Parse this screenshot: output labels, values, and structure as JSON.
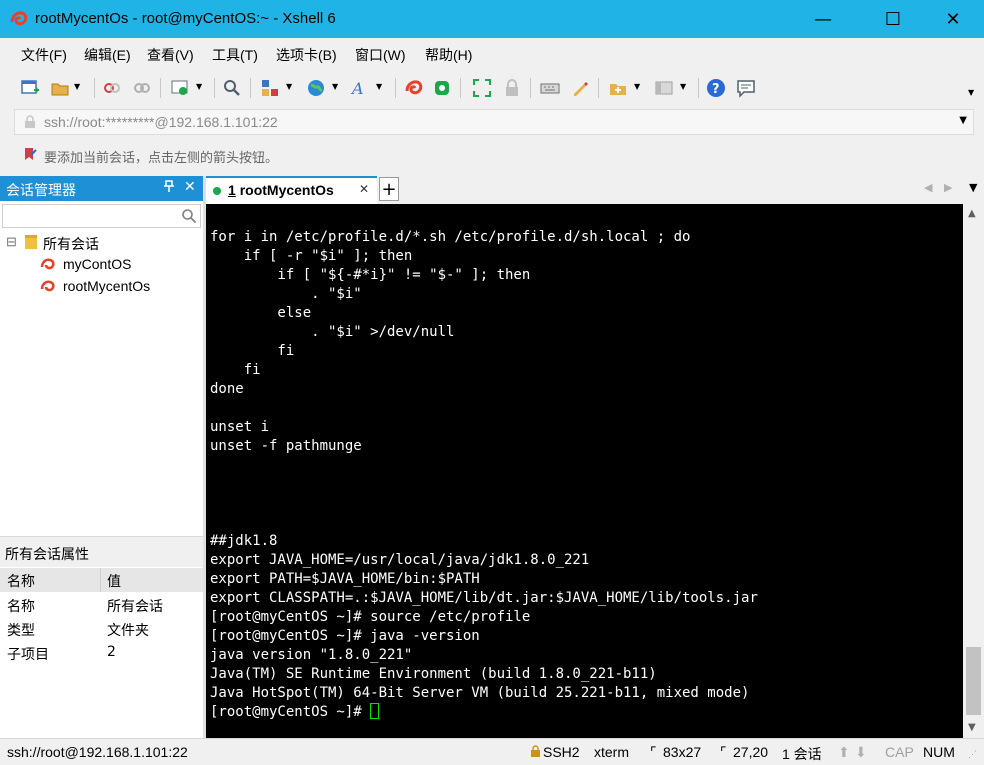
{
  "window": {
    "title": "rootMycentOs - root@myCentOS:~ - Xshell 6",
    "minimize_glyph": "—",
    "maximize_glyph": "☐",
    "close_glyph": "✕"
  },
  "menu": [
    "文件(F)",
    "编辑(E)",
    "查看(V)",
    "工具(T)",
    "选项卡(B)",
    "窗口(W)",
    "帮助(H)"
  ],
  "address_bar": {
    "value": "ssh://root:*********@192.168.1.101:22"
  },
  "hint": {
    "text": "要添加当前会话，点击左侧的箭头按钮。"
  },
  "session_manager": {
    "title": "会话管理器",
    "pin_glyph": "ᚹ",
    "close_glyph": "✕",
    "tree": [
      {
        "label": "所有会话",
        "toggle": "⊟"
      },
      {
        "label": "myContOS"
      },
      {
        "label": "rootMycentOs"
      }
    ]
  },
  "properties": {
    "title": "所有会话属性",
    "headers": [
      "名称",
      "值"
    ],
    "rows": [
      {
        "name": "名称",
        "value": "所有会话"
      },
      {
        "name": "类型",
        "value": "文件夹"
      },
      {
        "name": "子项目",
        "value": "2"
      }
    ]
  },
  "tab": {
    "number": "1",
    "label": "rootMycentOs",
    "close_glyph": "✕",
    "new_tab_glyph": "+"
  },
  "terminal": {
    "lines": [
      "for i in /etc/profile.d/*.sh /etc/profile.d/sh.local ; do",
      "    if [ -r \"$i\" ]; then",
      "        if [ \"${-#*i}\" != \"$-\" ]; then",
      "            . \"$i\"",
      "        else",
      "            . \"$i\" >/dev/null",
      "        fi",
      "    fi",
      "done",
      "",
      "unset i",
      "unset -f pathmunge",
      "",
      "",
      "",
      "",
      "##jdk1.8",
      "export JAVA_HOME=/usr/local/java/jdk1.8.0_221",
      "export PATH=$JAVA_HOME/bin:$PATH",
      "export CLASSPATH=.:$JAVA_HOME/lib/dt.jar:$JAVA_HOME/lib/tools.jar",
      "[root@myCentOS ~]# source /etc/profile",
      "[root@myCentOS ~]# java -version",
      "java version \"1.8.0_221\"",
      "Java(TM) SE Runtime Environment (build 1.8.0_221-b11)",
      "Java HotSpot(TM) 64-Bit Server VM (build 25.221-b11, mixed mode)"
    ],
    "prompt": "[root@myCentOS ~]# "
  },
  "status": {
    "connection": "ssh://root@192.168.1.101:22",
    "protocol": "SSH2",
    "term": "xterm",
    "size": "83x27",
    "cursor_pos": "27,20",
    "sessions": "1 会话",
    "cap": "CAP",
    "num": "NUM"
  },
  "colors": {
    "titlebar": "#20b4e6",
    "panel_header": "#1e90d6",
    "terminal_bg": "#000000",
    "terminal_fg": "#ffffff",
    "cursor": "#00e000",
    "status_dot": "#1aa84a"
  }
}
